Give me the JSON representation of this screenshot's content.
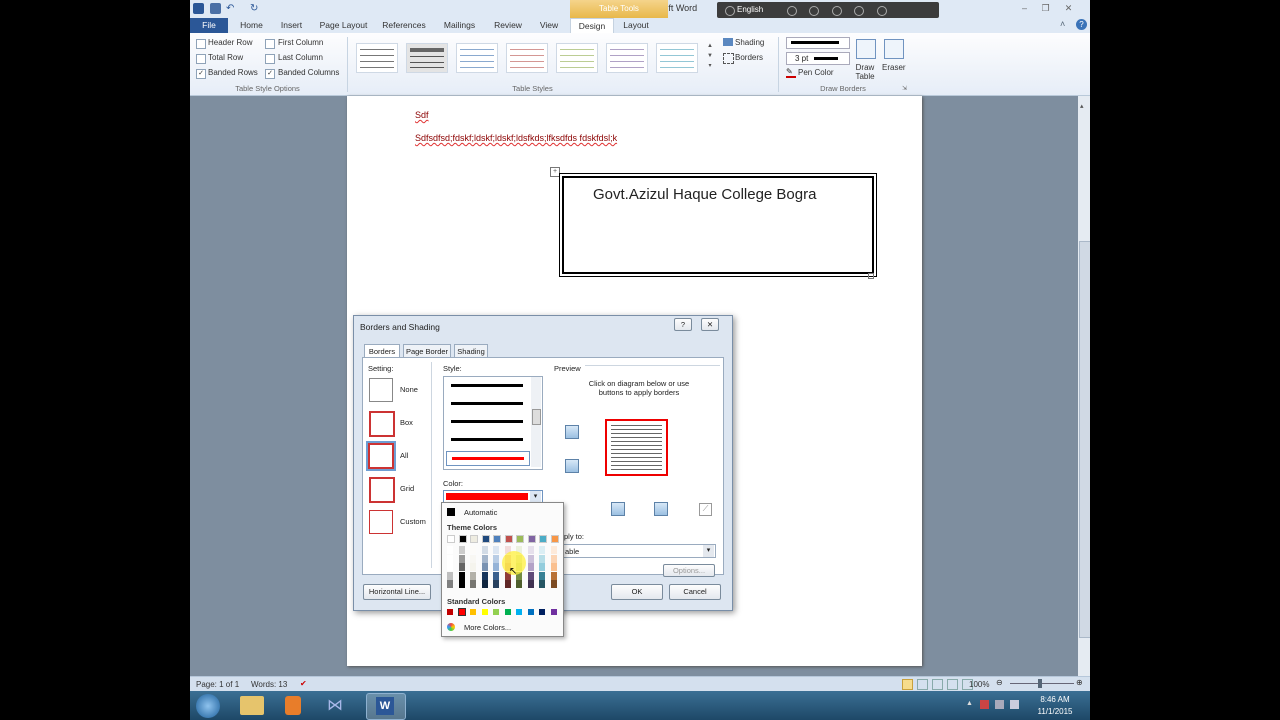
{
  "app": {
    "title": "Document1 - Microsoft Word",
    "contextual_tab": "Table Tools"
  },
  "tabs": [
    {
      "label": "File"
    },
    {
      "label": "Home"
    },
    {
      "label": "Insert"
    },
    {
      "label": "Page Layout"
    },
    {
      "label": "References"
    },
    {
      "label": "Mailings"
    },
    {
      "label": "Review"
    },
    {
      "label": "View"
    },
    {
      "label": "Design"
    },
    {
      "label": "Layout"
    }
  ],
  "langbar": {
    "language": "English"
  },
  "ribbon": {
    "style_options": {
      "group_label": "Table Style Options",
      "items": [
        {
          "label": "Header Row",
          "checked": false
        },
        {
          "label": "First Column",
          "checked": false
        },
        {
          "label": "Total Row",
          "checked": false
        },
        {
          "label": "Last Column",
          "checked": false
        },
        {
          "label": "Banded Rows",
          "checked": true
        },
        {
          "label": "Banded Columns",
          "checked": true
        }
      ]
    },
    "table_styles": {
      "group_label": "Table Styles"
    },
    "shading_label": "Shading",
    "borders_label": "Borders",
    "draw_borders": {
      "group_label": "Draw Borders",
      "pen_weight": "3 pt",
      "pen_color": "Pen Color",
      "draw_table": "Draw Table",
      "eraser": "Eraser"
    }
  },
  "document": {
    "line1": "Sdf",
    "line2": "Sdfsdfsd;fdskf;ldskf;ldskf;ldsfkds;lfksdfds fdskfdsl;k",
    "table_text": "Govt.Azizul Haque College Bogra"
  },
  "dialog": {
    "title": "Borders and Shading",
    "help": "?",
    "close": "✕",
    "tabs": [
      {
        "label": "Borders"
      },
      {
        "label": "Page Border"
      },
      {
        "label": "Shading"
      }
    ],
    "setting_label": "Setting:",
    "settings": [
      {
        "label": "None"
      },
      {
        "label": "Box"
      },
      {
        "label": "All"
      },
      {
        "label": "Grid"
      },
      {
        "label": "Custom"
      }
    ],
    "style_label": "Style:",
    "color_label": "Color:",
    "preview_label": "Preview",
    "preview_hint": "Click on diagram below or use buttons to apply borders",
    "apply_to_label": "ply to:",
    "apply_to_value": "able",
    "options_btn": "Options...",
    "horizontal_line_btn": "Horizontal Line...",
    "ok": "OK",
    "cancel": "Cancel",
    "selected_color": "#ff0000"
  },
  "palette": {
    "automatic": "Automatic",
    "theme_colors_label": "Theme Colors",
    "standard_colors_label": "Standard Colors",
    "more_colors": "More Colors...",
    "theme_top": [
      "#ffffff",
      "#000000",
      "#eeece1",
      "#1f497d",
      "#4f81bd",
      "#c0504d",
      "#9bbb59",
      "#8064a2",
      "#4bacc6",
      "#f79646"
    ],
    "standard": [
      "#c00000",
      "#ff0000",
      "#ffc000",
      "#ffff00",
      "#92d050",
      "#00b050",
      "#00b0f0",
      "#0070c0",
      "#002060",
      "#7030a0"
    ]
  },
  "status": {
    "page": "Page: 1 of 1",
    "words": "Words: 13",
    "zoom": "100%"
  },
  "tray": {
    "time": "8:46 AM",
    "date": "11/1/2015"
  }
}
